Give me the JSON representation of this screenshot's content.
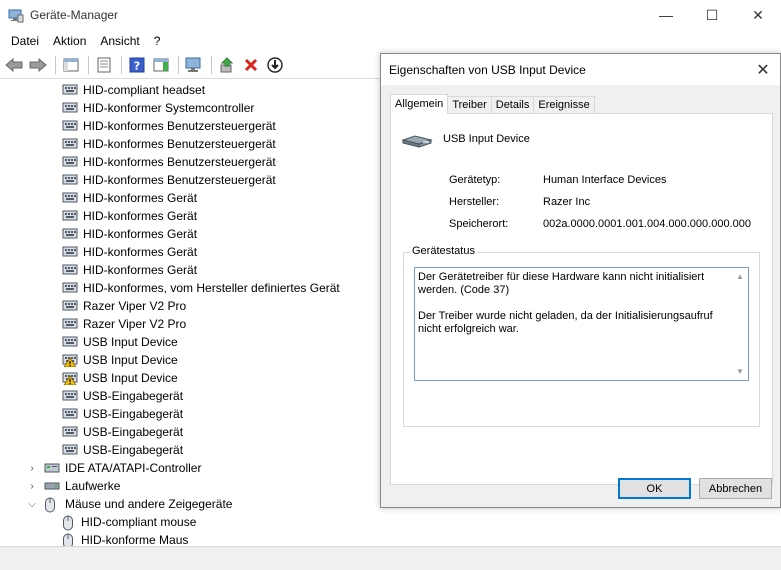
{
  "window": {
    "title": "Geräte-Manager",
    "minimize": "—",
    "maximize": "☐",
    "close": "✕"
  },
  "menu": [
    "Datei",
    "Aktion",
    "Ansicht",
    "?"
  ],
  "tree": {
    "children": [
      {
        "label": "HID-compliant headset",
        "icon": "hid-icon",
        "warning": false
      },
      {
        "label": "HID-konformer Systemcontroller",
        "icon": "hid-icon",
        "warning": false
      },
      {
        "label": "HID-konformes Benutzersteuergerät",
        "icon": "hid-icon",
        "warning": false
      },
      {
        "label": "HID-konformes Benutzersteuergerät",
        "icon": "hid-icon",
        "warning": false
      },
      {
        "label": "HID-konformes Benutzersteuergerät",
        "icon": "hid-icon",
        "warning": false
      },
      {
        "label": "HID-konformes Benutzersteuergerät",
        "icon": "hid-icon",
        "warning": false
      },
      {
        "label": "HID-konformes Gerät",
        "icon": "hid-icon",
        "warning": false
      },
      {
        "label": "HID-konformes Gerät",
        "icon": "hid-icon",
        "warning": false
      },
      {
        "label": "HID-konformes Gerät",
        "icon": "hid-icon",
        "warning": false
      },
      {
        "label": "HID-konformes Gerät",
        "icon": "hid-icon",
        "warning": false
      },
      {
        "label": "HID-konformes Gerät",
        "icon": "hid-icon",
        "warning": false
      },
      {
        "label": "HID-konformes, vom Hersteller definiertes Gerät",
        "icon": "hid-icon",
        "warning": false
      },
      {
        "label": "Razer Viper V2 Pro",
        "icon": "hid-icon",
        "warning": false
      },
      {
        "label": "Razer Viper V2 Pro",
        "icon": "hid-icon",
        "warning": false
      },
      {
        "label": "USB Input Device",
        "icon": "hid-icon",
        "warning": false
      },
      {
        "label": "USB Input Device",
        "icon": "hid-icon",
        "warning": true
      },
      {
        "label": "USB Input Device",
        "icon": "hid-icon",
        "warning": true
      },
      {
        "label": "USB-Eingabegerät",
        "icon": "hid-icon",
        "warning": false
      },
      {
        "label": "USB-Eingabegerät",
        "icon": "hid-icon",
        "warning": false
      },
      {
        "label": "USB-Eingabegerät",
        "icon": "hid-icon",
        "warning": false
      },
      {
        "label": "USB-Eingabegerät",
        "icon": "hid-icon",
        "warning": false
      }
    ],
    "categories": [
      {
        "label": "IDE ATA/ATAPI-Controller",
        "expanded": false
      },
      {
        "label": "Laufwerke",
        "expanded": false
      },
      {
        "label": "Mäuse und andere Zeigegeräte",
        "expanded": true
      }
    ],
    "mouse_children": [
      {
        "label": "HID-compliant mouse"
      },
      {
        "label": "HID-konforme Maus"
      }
    ]
  },
  "dialog": {
    "title": "Eigenschaften von USB Input Device",
    "close": "✕",
    "tabs": [
      "Allgemein",
      "Treiber",
      "Details",
      "Ereignisse"
    ],
    "device_name": "USB Input Device",
    "props": [
      {
        "key": "Gerätetyp:",
        "value": "Human Interface Devices"
      },
      {
        "key": "Hersteller:",
        "value": "Razer Inc"
      },
      {
        "key": "Speicherort:",
        "value": "002a.0000.0001.001.004.000.000.000.000"
      }
    ],
    "status_group": "Gerätestatus",
    "status_lines": [
      "Der Gerätetreiber für diese Hardware kann nicht initialisiert werden. (Code 37)",
      "Der Treiber wurde nicht geladen, da der Initialisierungsaufruf nicht erfolgreich war."
    ],
    "ok": "OK",
    "cancel": "Abbrechen"
  },
  "colors": {
    "accent": "#0078d7",
    "warning": "#f2c200",
    "error_red": "#d9261c"
  }
}
